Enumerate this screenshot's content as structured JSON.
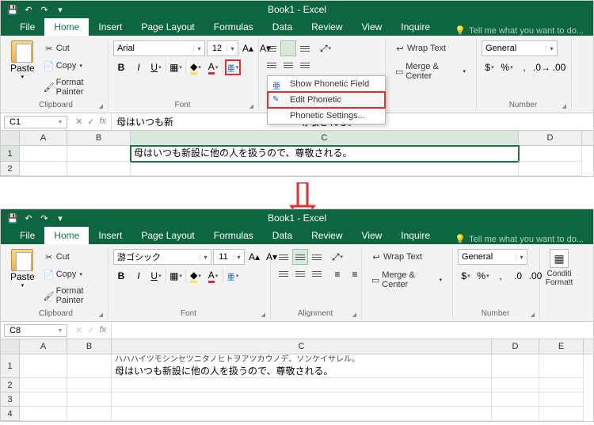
{
  "app": {
    "title": "Book1 - Excel",
    "tell": "Tell me what you want to do..."
  },
  "qat": {
    "save": "💾",
    "undo": "↶",
    "redo": "↷",
    "more": "▾"
  },
  "tabs": {
    "file": "File",
    "home": "Home",
    "insert": "Insert",
    "pagelayout": "Page Layout",
    "formulas": "Formulas",
    "data": "Data",
    "review": "Review",
    "view": "View",
    "inquire": "Inquire"
  },
  "clipboard": {
    "paste": "Paste",
    "cut": "Cut",
    "copy": "Copy",
    "painter": "Format Painter",
    "label": "Clipboard"
  },
  "font1": {
    "name": "Arial",
    "size": "12",
    "label": "Font"
  },
  "font2": {
    "name": "游ゴシック",
    "size": "11",
    "label": "Font"
  },
  "alignment": {
    "label": "Alignment",
    "label_short": "ment",
    "wrap": "Wrap Text",
    "merge": "Merge & Center"
  },
  "number": {
    "format": "General",
    "label": "Number"
  },
  "cond": {
    "label1": "Conditi",
    "label2": "Formatt"
  },
  "phonetic_menu": {
    "show": "Show Phonetic Field",
    "edit": "Edit Phonetic",
    "settings": "Phonetic Settings..."
  },
  "before": {
    "namebox": "C1",
    "formula": "母はいつも新",
    "formula_tail": "尊敬される。",
    "cols": {
      "A": "A",
      "B": "B",
      "C": "C",
      "D": "D"
    },
    "widths": {
      "A": 60,
      "B": 80,
      "C": 490,
      "D": 80
    },
    "rows": [
      {
        "h": "1",
        "C": "母はいつも新設に他の人を扱うので、尊敬される。",
        "sel": true,
        "height": 20
      },
      {
        "h": "2",
        "C": "",
        "height": 18
      }
    ]
  },
  "after": {
    "namebox": "C8",
    "formula": "",
    "cols": {
      "A": "A",
      "B": "B",
      "C": "C",
      "D": "D",
      "E": "E"
    },
    "widths": {
      "A": 60,
      "B": 56,
      "C": 480,
      "D": 60,
      "E": 56
    },
    "rows": [
      {
        "h": "1",
        "phon": "ハハハイツモシンセツニタノヒトヲアツカウノデ、ソンケイサレル。",
        "C": "母はいつも新設に他の人を扱うので、尊敬される。",
        "height": 30
      },
      {
        "h": "2",
        "C": "",
        "height": 18
      },
      {
        "h": "3",
        "C": "",
        "height": 18
      },
      {
        "h": "4",
        "C": "",
        "height": 18
      }
    ]
  }
}
